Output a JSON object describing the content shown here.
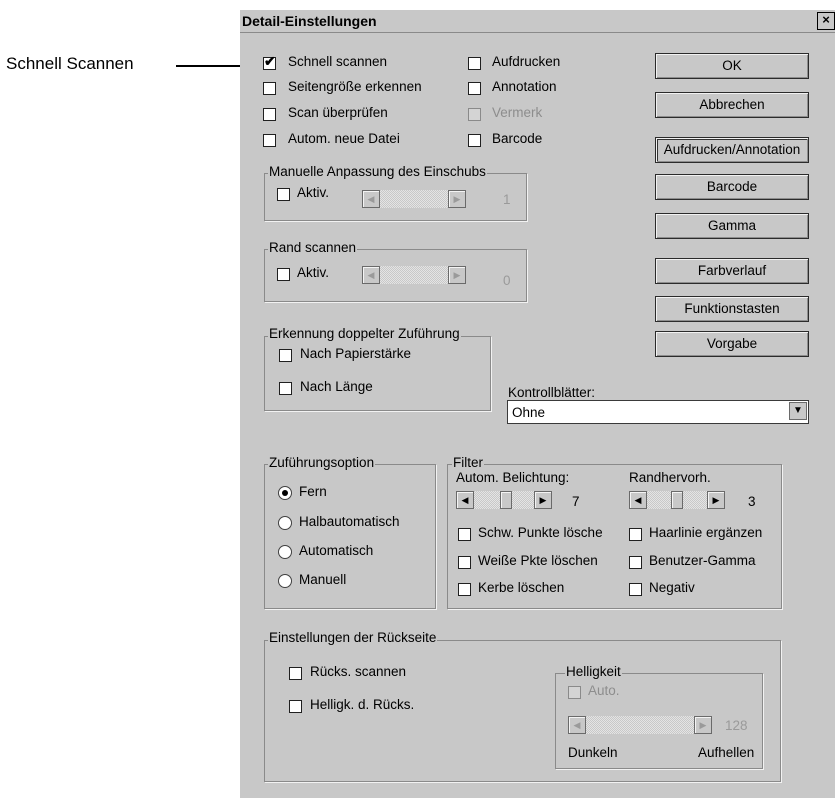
{
  "callout": {
    "label": "Schnell Scannen"
  },
  "window": {
    "title": "Detail-Einstellungen",
    "close_glyph": "×"
  },
  "options": {
    "schnell_scannen": {
      "label": "Schnell scannen",
      "checked": true
    },
    "seitengroesse": {
      "label": "Seitengröße erkennen",
      "checked": false
    },
    "scan_ueberpruefen": {
      "label": "Scan überprüfen",
      "checked": false
    },
    "autom_neue_datei": {
      "label": "Autom. neue Datei",
      "checked": false
    },
    "aufdrucken": {
      "label": "Aufdrucken",
      "checked": false
    },
    "annotation": {
      "label": "Annotation",
      "checked": false
    },
    "vermerk": {
      "label": "Vermerk",
      "checked": false,
      "disabled": true
    },
    "barcode": {
      "label": "Barcode",
      "checked": false
    }
  },
  "buttons": {
    "ok": "OK",
    "abbrechen": "Abbrechen",
    "aufdrucken_annotation": "Aufdrucken/Annotation",
    "barcode": "Barcode",
    "gamma": "Gamma",
    "farbverlauf": "Farbverlauf",
    "funktionstasten": "Funktionstasten",
    "vorgabe": "Vorgabe"
  },
  "manuelle_anpassung": {
    "title": "Manuelle Anpassung des Einschubs",
    "aktiv_label": "Aktiv.",
    "value": "1"
  },
  "rand_scannen": {
    "title": "Rand scannen",
    "aktiv_label": "Aktiv.",
    "value": "0"
  },
  "doppelte_zufuehrung": {
    "title": "Erkennung doppelter Zuführung",
    "nach_papierstaerke": "Nach Papierstärke",
    "nach_laenge": "Nach Länge"
  },
  "kontrollblaetter": {
    "label": "Kontrollblätter:",
    "selected": "Ohne"
  },
  "zufuehrungsoption": {
    "title": "Zuführungsoption",
    "selected": "Fern",
    "options": [
      "Fern",
      "Halbautomatisch",
      "Automatisch",
      "Manuell"
    ]
  },
  "filter": {
    "title": "Filter",
    "autom_belichtung": {
      "label": "Autom. Belichtung:",
      "value": "7"
    },
    "randhervorh": {
      "label": "Randhervorh.",
      "value": "3"
    },
    "schw_punkte": "Schw. Punkte lösche",
    "weisse_pkte": "Weiße Pkte löschen",
    "kerbe": "Kerbe löschen",
    "haarlinie": "Haarlinie ergänzen",
    "benutzer_gamma": "Benutzer-Gamma",
    "negativ": "Negativ"
  },
  "rueckseite": {
    "title": "Einstellungen der Rückseite",
    "ruecks_scannen": "Rücks. scannen",
    "helligk_ruecks": "Helligk. d. Rücks.",
    "helligkeit": {
      "title": "Helligkeit",
      "auto_label": "Auto.",
      "value": "128",
      "dunkeln": "Dunkeln",
      "aufhellen": "Aufhellen"
    }
  },
  "glyphs": {
    "check": "✔",
    "arrow_left": "◀",
    "arrow_right": "▶",
    "arrow_down": "▼"
  }
}
